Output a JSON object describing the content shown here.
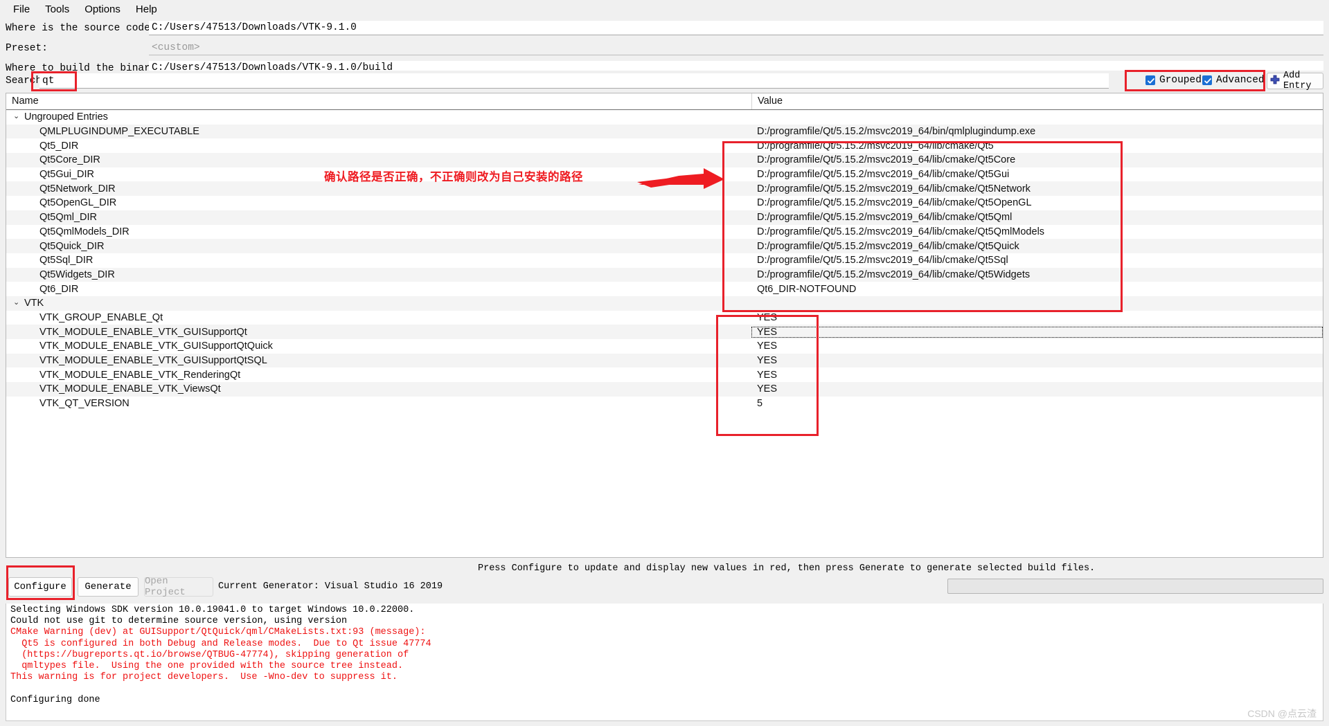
{
  "menubar": {
    "items": [
      {
        "label": "File"
      },
      {
        "label": "Tools"
      },
      {
        "label": "Options"
      },
      {
        "label": "Help"
      }
    ]
  },
  "form": {
    "source_label": "Where is the source code:",
    "source_value": "C:/Users/47513/Downloads/VTK-9.1.0",
    "preset_label": "Preset:",
    "preset_value": "<custom>",
    "build_label": "Where to build the binaries:",
    "build_value": "C:/Users/47513/Downloads/VTK-9.1.0/build"
  },
  "search": {
    "label": "Search:",
    "value": "qt",
    "grouped_label": "Grouped",
    "grouped_checked": true,
    "advanced_label": "Advanced",
    "advanced_checked": true,
    "add_entry_label": "Add Entry"
  },
  "table": {
    "col_name": "Name",
    "col_value": "Value",
    "groups": [
      {
        "label": "Ungrouped Entries",
        "expanded": true,
        "entries": [
          {
            "name": "QMLPLUGINDUMP_EXECUTABLE",
            "value": "D:/programfile/Qt/5.15.2/msvc2019_64/bin/qmlplugindump.exe"
          },
          {
            "name": "Qt5_DIR",
            "value": "D:/programfile/Qt/5.15.2/msvc2019_64/lib/cmake/Qt5"
          },
          {
            "name": "Qt5Core_DIR",
            "value": "D:/programfile/Qt/5.15.2/msvc2019_64/lib/cmake/Qt5Core"
          },
          {
            "name": "Qt5Gui_DIR",
            "value": "D:/programfile/Qt/5.15.2/msvc2019_64/lib/cmake/Qt5Gui"
          },
          {
            "name": "Qt5Network_DIR",
            "value": "D:/programfile/Qt/5.15.2/msvc2019_64/lib/cmake/Qt5Network"
          },
          {
            "name": "Qt5OpenGL_DIR",
            "value": "D:/programfile/Qt/5.15.2/msvc2019_64/lib/cmake/Qt5OpenGL"
          },
          {
            "name": "Qt5Qml_DIR",
            "value": "D:/programfile/Qt/5.15.2/msvc2019_64/lib/cmake/Qt5Qml"
          },
          {
            "name": "Qt5QmlModels_DIR",
            "value": "D:/programfile/Qt/5.15.2/msvc2019_64/lib/cmake/Qt5QmlModels"
          },
          {
            "name": "Qt5Quick_DIR",
            "value": "D:/programfile/Qt/5.15.2/msvc2019_64/lib/cmake/Qt5Quick"
          },
          {
            "name": "Qt5Sql_DIR",
            "value": "D:/programfile/Qt/5.15.2/msvc2019_64/lib/cmake/Qt5Sql"
          },
          {
            "name": "Qt5Widgets_DIR",
            "value": "D:/programfile/Qt/5.15.2/msvc2019_64/lib/cmake/Qt5Widgets"
          },
          {
            "name": "Qt6_DIR",
            "value": "Qt6_DIR-NOTFOUND"
          }
        ]
      },
      {
        "label": "VTK",
        "expanded": true,
        "entries": [
          {
            "name": "VTK_GROUP_ENABLE_Qt",
            "value": "YES"
          },
          {
            "name": "VTK_MODULE_ENABLE_VTK_GUISupportQt",
            "value": "YES",
            "focused": true
          },
          {
            "name": "VTK_MODULE_ENABLE_VTK_GUISupportQtQuick",
            "value": "YES"
          },
          {
            "name": "VTK_MODULE_ENABLE_VTK_GUISupportQtSQL",
            "value": "YES"
          },
          {
            "name": "VTK_MODULE_ENABLE_VTK_RenderingQt",
            "value": "YES"
          },
          {
            "name": "VTK_MODULE_ENABLE_VTK_ViewsQt",
            "value": "YES"
          },
          {
            "name": "VTK_QT_VERSION",
            "value": "5"
          }
        ]
      }
    ]
  },
  "annotations": {
    "note_text": "确认路径是否正确，不正确则改为自己安装的路径",
    "color": "#ee1c22"
  },
  "bottom": {
    "hint": "Press Configure to update and display new values in red, then press Generate to generate selected build files.",
    "configure_label": "Configure",
    "generate_label": "Generate",
    "open_project_label": "Open Project",
    "generator_text": "Current Generator: Visual Studio 16 2019"
  },
  "console": {
    "lines": [
      {
        "text": "Selecting Windows SDK version 10.0.19041.0 to target Windows 10.0.22000.",
        "warn": false
      },
      {
        "text": "Could not use git to determine source version, using version",
        "warn": false
      },
      {
        "text": "CMake Warning (dev) at GUISupport/QtQuick/qml/CMakeLists.txt:93 (message):",
        "warn": true
      },
      {
        "text": "  Qt5 is configured in both Debug and Release modes.  Due to Qt issue 47774",
        "warn": true
      },
      {
        "text": "  (https://bugreports.qt.io/browse/QTBUG-47774), skipping generation of",
        "warn": true
      },
      {
        "text": "  qmltypes file.  Using the one provided with the source tree instead.",
        "warn": true
      },
      {
        "text": "This warning is for project developers.  Use -Wno-dev to suppress it.",
        "warn": true
      },
      {
        "text": "",
        "warn": false
      },
      {
        "text": "Configuring done",
        "warn": false
      }
    ]
  },
  "watermark": {
    "text": "CSDN @点云渣"
  }
}
